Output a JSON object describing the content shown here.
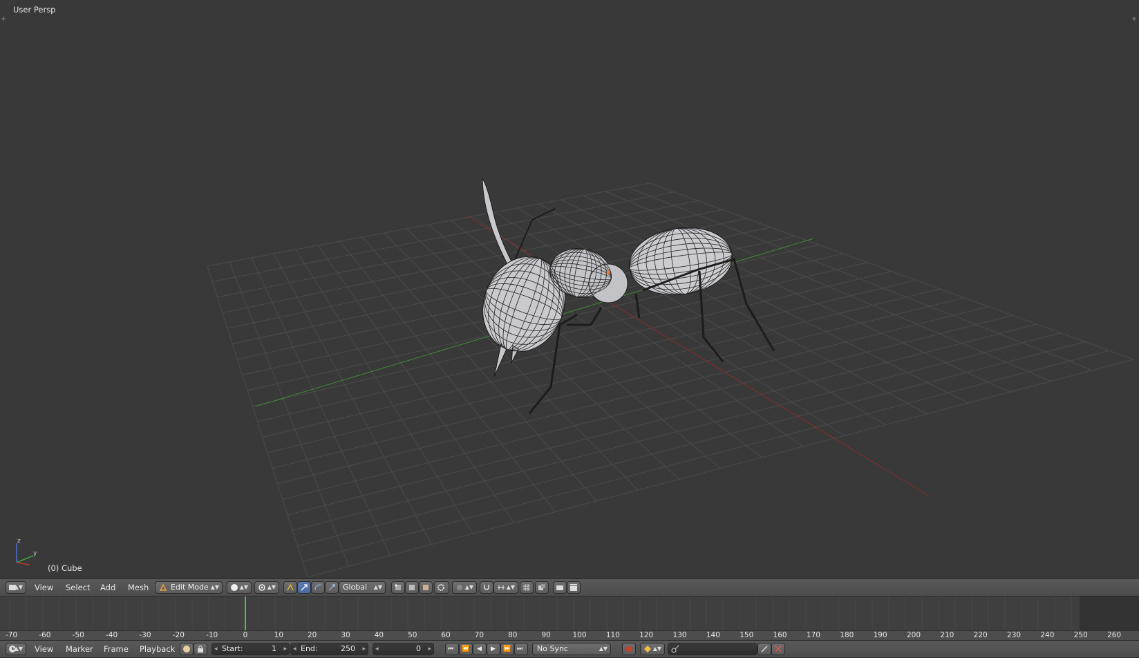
{
  "viewport": {
    "title": "User Persp",
    "object_label": "(0) Cube",
    "axis_labels": {
      "z": "z",
      "y": "y"
    }
  },
  "view3d_header": {
    "menus": [
      "View",
      "Select",
      "Add",
      "Mesh"
    ],
    "mode": "Edit Mode",
    "orientation": "Global"
  },
  "timeline": {
    "current_frame_marker": 0,
    "ticks": [
      "-70",
      "-60",
      "-50",
      "-40",
      "-30",
      "-20",
      "-10",
      "0",
      "10",
      "20",
      "30",
      "40",
      "50",
      "60",
      "70",
      "80",
      "90",
      "100",
      "110",
      "120",
      "130",
      "140",
      "150",
      "160",
      "170",
      "180",
      "190",
      "200",
      "210",
      "220",
      "230",
      "240",
      "250",
      "260"
    ]
  },
  "timeline_header": {
    "menus": [
      "View",
      "Marker",
      "Frame",
      "Playback"
    ],
    "start_label": "Start:",
    "start_value": "1",
    "end_label": "End:",
    "end_value": "250",
    "current_frame": "0",
    "sync": "No Sync"
  },
  "colors": {
    "background": "#393939",
    "grid": "#4a4a4a",
    "x_axis": "#8a2b2b",
    "y_axis": "#3f8a33",
    "accent": "#5a7ab0"
  }
}
